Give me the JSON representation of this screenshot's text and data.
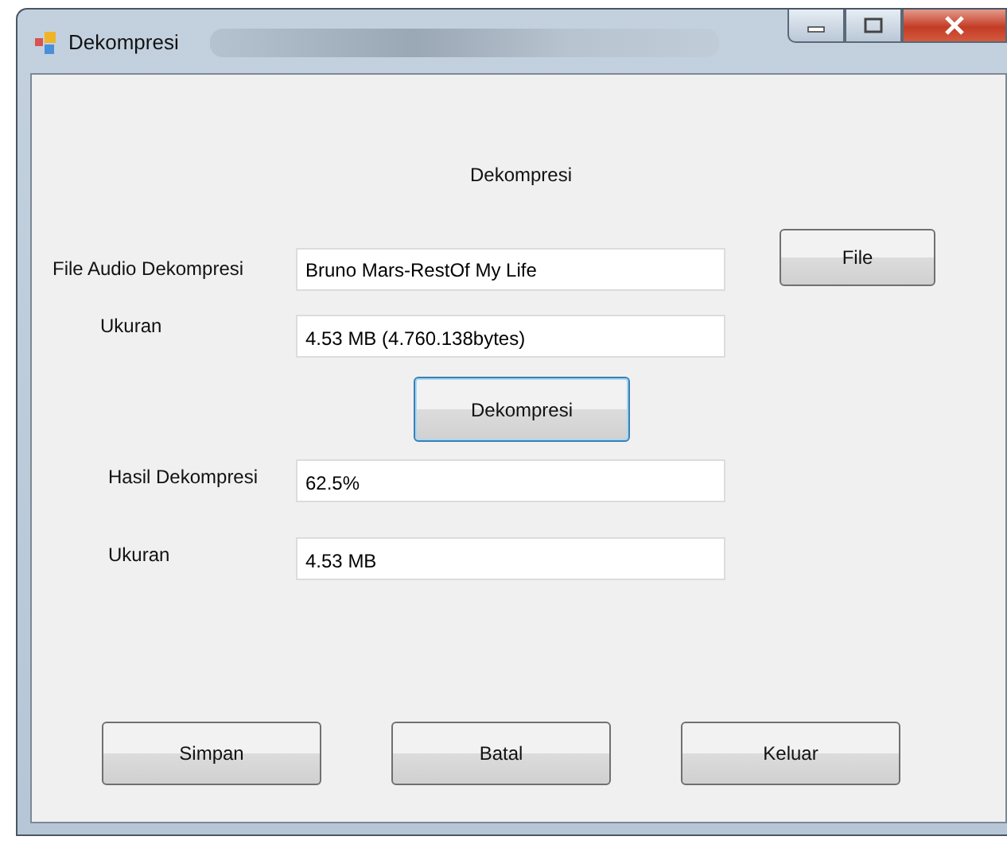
{
  "window": {
    "title": "Dekompresi"
  },
  "heading": "Dekompresi",
  "source_fields": [
    {
      "label": "File Audio Dekompresi",
      "value": "Bruno Mars-RestOf My Life"
    },
    {
      "label": "Ukuran",
      "value": "4.53 MB (4.760.138bytes)"
    }
  ],
  "file_button": "File",
  "action_button": {
    "label": "Dekompresi",
    "focused": true
  },
  "result_fields": [
    {
      "label": "Hasil Dekompresi",
      "value": "62.5%"
    },
    {
      "label": "Ukuran",
      "value": "4.53 MB"
    }
  ],
  "buttons": [
    "Simpan",
    "Batal",
    "Keluar"
  ]
}
